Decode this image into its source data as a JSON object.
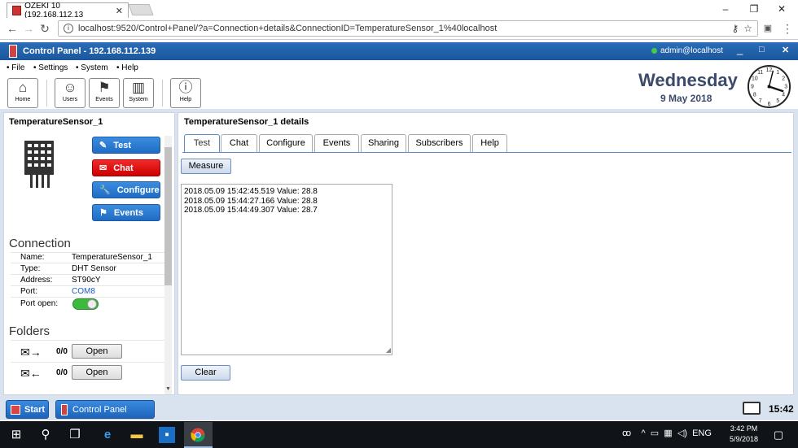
{
  "browser": {
    "tab_title": "OZEKI 10 (192.168.112.13",
    "url": "localhost:9520/Control+Panel/?a=Connection+details&ConnectionID=TemperatureSensor_1%40localhost"
  },
  "app": {
    "title": "Control Panel - 192.168.112.139",
    "user": "admin@localhost",
    "menu": [
      "File",
      "Settings",
      "System",
      "Help"
    ],
    "toolbar": [
      {
        "label": "Home",
        "icon": "home-icon"
      },
      {
        "label": "Users",
        "icon": "users-icon"
      },
      {
        "label": "Events",
        "icon": "events-icon"
      },
      {
        "label": "System",
        "icon": "system-icon"
      },
      {
        "label": "Help",
        "icon": "help-icon"
      }
    ],
    "day": "Wednesday",
    "date": "9 May 2018"
  },
  "left": {
    "title": "TemperatureSensor_1",
    "actions": [
      "Test",
      "Chat",
      "Configure",
      "Events"
    ],
    "connection_heading": "Connection",
    "connection": [
      {
        "k": "Name:",
        "v": "TemperatureSensor_1"
      },
      {
        "k": "Type:",
        "v": "DHT Sensor"
      },
      {
        "k": "Address:",
        "v": "ST90cY"
      },
      {
        "k": "Port:",
        "v": "COM8"
      },
      {
        "k": "Port open:",
        "v": ""
      }
    ],
    "port_open": true,
    "folders_heading": "Folders",
    "folders": [
      {
        "count": "0/0",
        "button": "Open"
      },
      {
        "count": "0/0",
        "button": "Open"
      }
    ]
  },
  "right": {
    "title": "TemperatureSensor_1 details",
    "tabs": [
      "Test",
      "Chat",
      "Configure",
      "Events",
      "Sharing",
      "Subscribers",
      "Help"
    ],
    "active_tab": "Test",
    "measure_label": "Measure",
    "log": [
      "2018.05.09 15:42:45.519 Value: 28.8",
      "2018.05.09 15:44:27.166 Value: 28.8",
      "2018.05.09 15:44:49.307 Value: 28.7"
    ],
    "clear_label": "Clear"
  },
  "bottom": {
    "start": "Start",
    "task": "Control Panel",
    "time": "15:42"
  },
  "taskbar": {
    "lang": "ENG",
    "time": "3:42 PM",
    "date": "5/9/2018"
  }
}
